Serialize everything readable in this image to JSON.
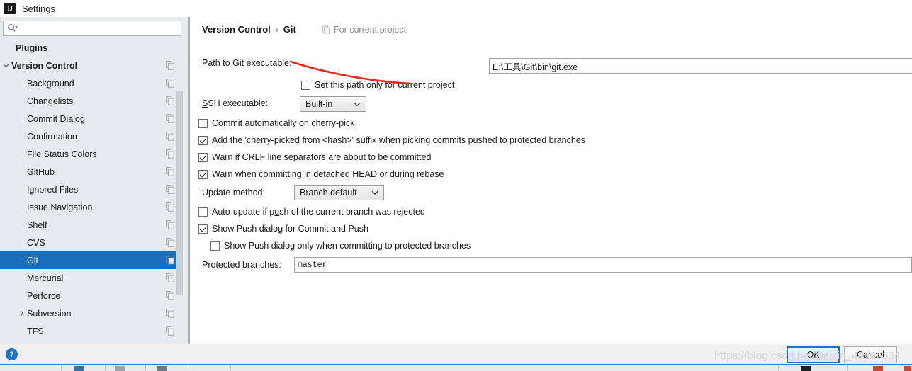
{
  "window": {
    "title": "Settings",
    "logo_text": "IJ",
    "logo_icon": "intellij-idea-icon"
  },
  "sidebar": {
    "search": {
      "placeholder": "",
      "value": "",
      "icon": "search-icon"
    },
    "items": [
      {
        "label": "Plugins",
        "level": 0,
        "arrow": "none",
        "copy": false,
        "selected": false
      },
      {
        "label": "Version Control",
        "level": 0,
        "arrow": "expanded",
        "copy": true,
        "selected": false
      },
      {
        "label": "Background",
        "level": 1,
        "arrow": "none",
        "copy": true,
        "selected": false
      },
      {
        "label": "Changelists",
        "level": 1,
        "arrow": "none",
        "copy": true,
        "selected": false
      },
      {
        "label": "Commit Dialog",
        "level": 1,
        "arrow": "none",
        "copy": true,
        "selected": false
      },
      {
        "label": "Confirmation",
        "level": 1,
        "arrow": "none",
        "copy": true,
        "selected": false
      },
      {
        "label": "File Status Colors",
        "level": 1,
        "arrow": "none",
        "copy": true,
        "selected": false
      },
      {
        "label": "GitHub",
        "level": 1,
        "arrow": "none",
        "copy": true,
        "selected": false
      },
      {
        "label": "Ignored Files",
        "level": 1,
        "arrow": "none",
        "copy": true,
        "selected": false
      },
      {
        "label": "Issue Navigation",
        "level": 1,
        "arrow": "none",
        "copy": true,
        "selected": false
      },
      {
        "label": "Shelf",
        "level": 1,
        "arrow": "none",
        "copy": true,
        "selected": false
      },
      {
        "label": "CVS",
        "level": 1,
        "arrow": "none",
        "copy": true,
        "selected": false
      },
      {
        "label": "Git",
        "level": 1,
        "arrow": "none",
        "copy": true,
        "selected": true
      },
      {
        "label": "Mercurial",
        "level": 1,
        "arrow": "none",
        "copy": true,
        "selected": false
      },
      {
        "label": "Perforce",
        "level": 1,
        "arrow": "none",
        "copy": true,
        "selected": false
      },
      {
        "label": "Subversion",
        "level": 1,
        "arrow": "collapsed",
        "copy": true,
        "selected": false
      },
      {
        "label": "TFS",
        "level": 1,
        "arrow": "none",
        "copy": true,
        "selected": false
      }
    ]
  },
  "main": {
    "breadcrumb": {
      "parent": "Version Control",
      "separator": "›",
      "current": "Git"
    },
    "scope": {
      "icon": "project-scope-icon",
      "label": "For current project"
    },
    "fields": {
      "git_path": {
        "label_pre": "Path to ",
        "label_mnemonic": "G",
        "label_post": "it executable:",
        "value": "E:\\工具\\Git\\bin\\git.exe",
        "browse_label": "•••"
      },
      "ssh_executable": {
        "label_mnemonic": "S",
        "label_pre": "",
        "label_post": "SH executable:",
        "value": "Built-in"
      },
      "update_method": {
        "label": "Update method:",
        "value": "Branch default"
      },
      "protected_branches": {
        "label": "Protected branches:",
        "value": "master"
      }
    },
    "checkboxes": [
      {
        "id": "set-path-current-project",
        "label": "Set this path only for current project",
        "checked": false
      },
      {
        "id": "commit-auto-cherry-pick",
        "label": "Commit automatically on cherry-pick",
        "checked": false
      },
      {
        "id": "add-cherry-picked-suffix",
        "label": "Add the 'cherry-picked from <hash>' suffix when picking commits pushed to protected branches",
        "checked": true
      },
      {
        "id": "warn-crlf",
        "label_pre": "Warn if ",
        "label_mnemonic": "C",
        "label_post": "RLF line separators are about to be committed",
        "label": "Warn if CRLF line separators are about to be committed",
        "checked": true
      },
      {
        "id": "warn-detached-head",
        "label": "Warn when committing in detached HEAD or during rebase",
        "checked": true
      },
      {
        "id": "auto-update-rejected",
        "label_pre": "Auto-update if p",
        "label_mnemonic": "u",
        "label_post": "sh of the current branch was rejected",
        "label": "Auto-update if push of the current branch was rejected",
        "checked": false
      },
      {
        "id": "show-push-dialog",
        "label": "Show Push dialog for Commit and Push",
        "checked": true
      },
      {
        "id": "show-push-dialog-protected",
        "label": "Show Push dialog only when committing to protected branches",
        "checked": false
      }
    ]
  },
  "footer": {
    "help_label": "?",
    "ok_label": "OK",
    "cancel_label": "Cancel"
  },
  "watermark": "https://blog.csdn.net/weixin_44166334",
  "colors": {
    "selection_blue": "#1a6fbd",
    "default_button_border": "#1e72c6",
    "sidebar_bg": "#e6ebef",
    "annotation_red": "#e8261c",
    "help_blue": "#1a75cf"
  }
}
